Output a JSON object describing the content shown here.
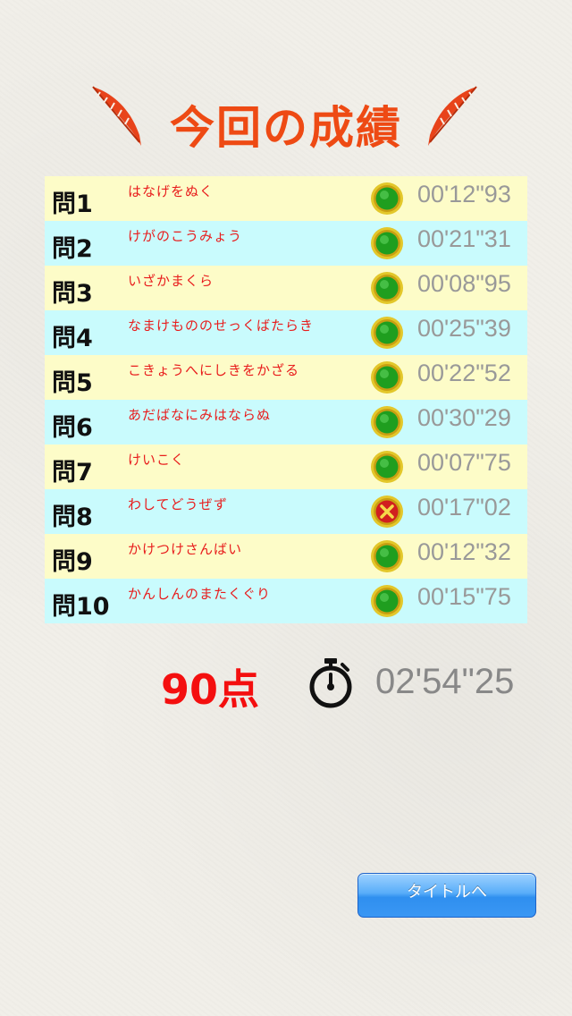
{
  "header": {
    "title": "今回の成績"
  },
  "results": [
    {
      "label": "問1",
      "phrase": "はなげをぬく",
      "result": "correct",
      "time": "00'12\"93"
    },
    {
      "label": "問2",
      "phrase": "けがのこうみょう",
      "result": "correct",
      "time": "00'21\"31"
    },
    {
      "label": "問3",
      "phrase": "いざかまくら",
      "result": "correct",
      "time": "00'08\"95"
    },
    {
      "label": "問4",
      "phrase": "なまけもののせっくばたらき",
      "result": "correct",
      "time": "00'25\"39"
    },
    {
      "label": "問5",
      "phrase": "こきょうへにしきをかざる",
      "result": "correct",
      "time": "00'22\"52"
    },
    {
      "label": "問6",
      "phrase": "あだばなにみはならぬ",
      "result": "correct",
      "time": "00'30\"29"
    },
    {
      "label": "問7",
      "phrase": "けいこく",
      "result": "correct",
      "time": "00'07\"75"
    },
    {
      "label": "問8",
      "phrase": "わしてどうぜず",
      "result": "incorrect",
      "time": "00'17\"02"
    },
    {
      "label": "問9",
      "phrase": "かけつけさんばい",
      "result": "correct",
      "time": "00'12\"32"
    },
    {
      "label": "問10",
      "phrase": "かんしんのまたくぐり",
      "result": "correct",
      "time": "00'15\"75"
    }
  ],
  "summary": {
    "score": "90点",
    "total_time": "02'54\"25",
    "timer_icon": "stopwatch-icon"
  },
  "footer": {
    "title_button_label": "タイトルへ"
  },
  "colors": {
    "title": "#ee4a14",
    "row_yellow": "#fdfcc8",
    "row_cyan": "#c9fbfd",
    "phrase": "#e81c1c",
    "score": "#f40f0f",
    "correct_mark": "#1f9e1f",
    "incorrect_mark": "#d11f1f",
    "button": "#3a97f4"
  }
}
